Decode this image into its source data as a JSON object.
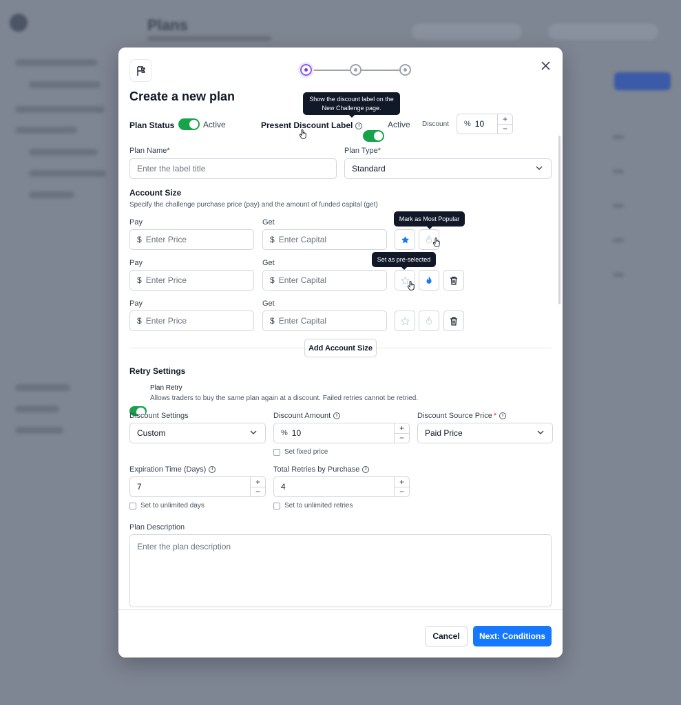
{
  "modal": {
    "title": "Create a new plan",
    "close_icon": "close-icon",
    "steps": [
      {
        "state": "active"
      },
      {
        "state": "inactive"
      },
      {
        "state": "inactive"
      }
    ]
  },
  "status": {
    "plan_status_label": "Plan Status",
    "plan_status_value": "Active",
    "discount_label_label": "Present Discount Label",
    "discount_label_value": "Active",
    "discount_label_tooltip": "Show the discount label on the New Challenge page.",
    "discount_label": "Discount",
    "discount_prefix": "%",
    "discount_value": "10"
  },
  "plan": {
    "name_label": "Plan Name*",
    "name_placeholder": "Enter the label title",
    "type_label": "Plan Type*",
    "type_value": "Standard"
  },
  "account_size": {
    "title": "Account Size",
    "description": "Specify the challenge purchase price (pay) and the amount of funded capital (get)",
    "pay_label": "Pay",
    "get_label": "Get",
    "currency": "$",
    "pay_placeholder": "Enter Price",
    "get_placeholder": "Enter Capital",
    "tooltip_popular": "Mark as Most Popular",
    "tooltip_preselected": "Set as pre-selected",
    "add_button": "Add Account Size",
    "rows": [
      {
        "star_active": true,
        "flame_active": false,
        "deletable": false
      },
      {
        "star_active": false,
        "flame_active": true,
        "deletable": true
      },
      {
        "star_active": false,
        "flame_active": false,
        "deletable": true
      }
    ]
  },
  "retry": {
    "title": "Retry Settings",
    "toggle_label": "Plan Retry",
    "toggle_description": "Allows traders to buy the same plan again at a discount. Failed retries cannot be retried.",
    "discount_settings_label": "Discount Settings",
    "discount_settings_value": "Custom",
    "discount_amount_label": "Discount Amount",
    "discount_amount_prefix": "%",
    "discount_amount_value": "10",
    "fixed_price_label": "Set fixed price",
    "source_price_label": "Discount Source Price",
    "source_price_required": "*",
    "source_price_value": "Paid Price",
    "expiration_label": "Expiration Time (Days)",
    "expiration_value": "7",
    "unlimited_days_label": "Set to unlimited days",
    "total_retries_label": "Total Retries by Purchase",
    "total_retries_value": "4",
    "unlimited_retries_label": "Set to unlimited retries"
  },
  "description": {
    "label": "Plan Description",
    "placeholder": "Enter the plan description"
  },
  "footer": {
    "cancel": "Cancel",
    "next": "Next: Conditions"
  },
  "stepper_symbols": {
    "plus": "+",
    "minus": "−"
  },
  "info_symbol": "i",
  "colors": {
    "accent": "#1677ff",
    "toggle_on": "#16a34a",
    "step_active": "#7c3aed",
    "required": "#dc2626"
  }
}
